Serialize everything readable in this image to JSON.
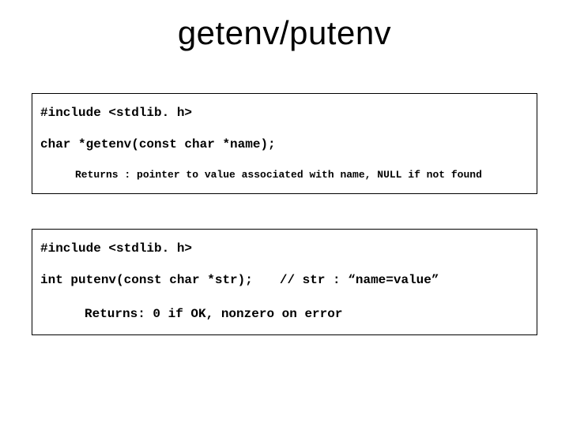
{
  "title": "getenv/putenv",
  "box1": {
    "include": "#include <stdlib. h>",
    "prototype": "char *getenv(const char *name);",
    "returns": "Returns : pointer to value associated with name, NULL if not found"
  },
  "box2": {
    "include": "#include <stdlib. h>",
    "prototype": "int putenv(const char *str);",
    "comment": "// str : “name=value”",
    "returns": "Returns: 0 if OK, nonzero on error"
  }
}
